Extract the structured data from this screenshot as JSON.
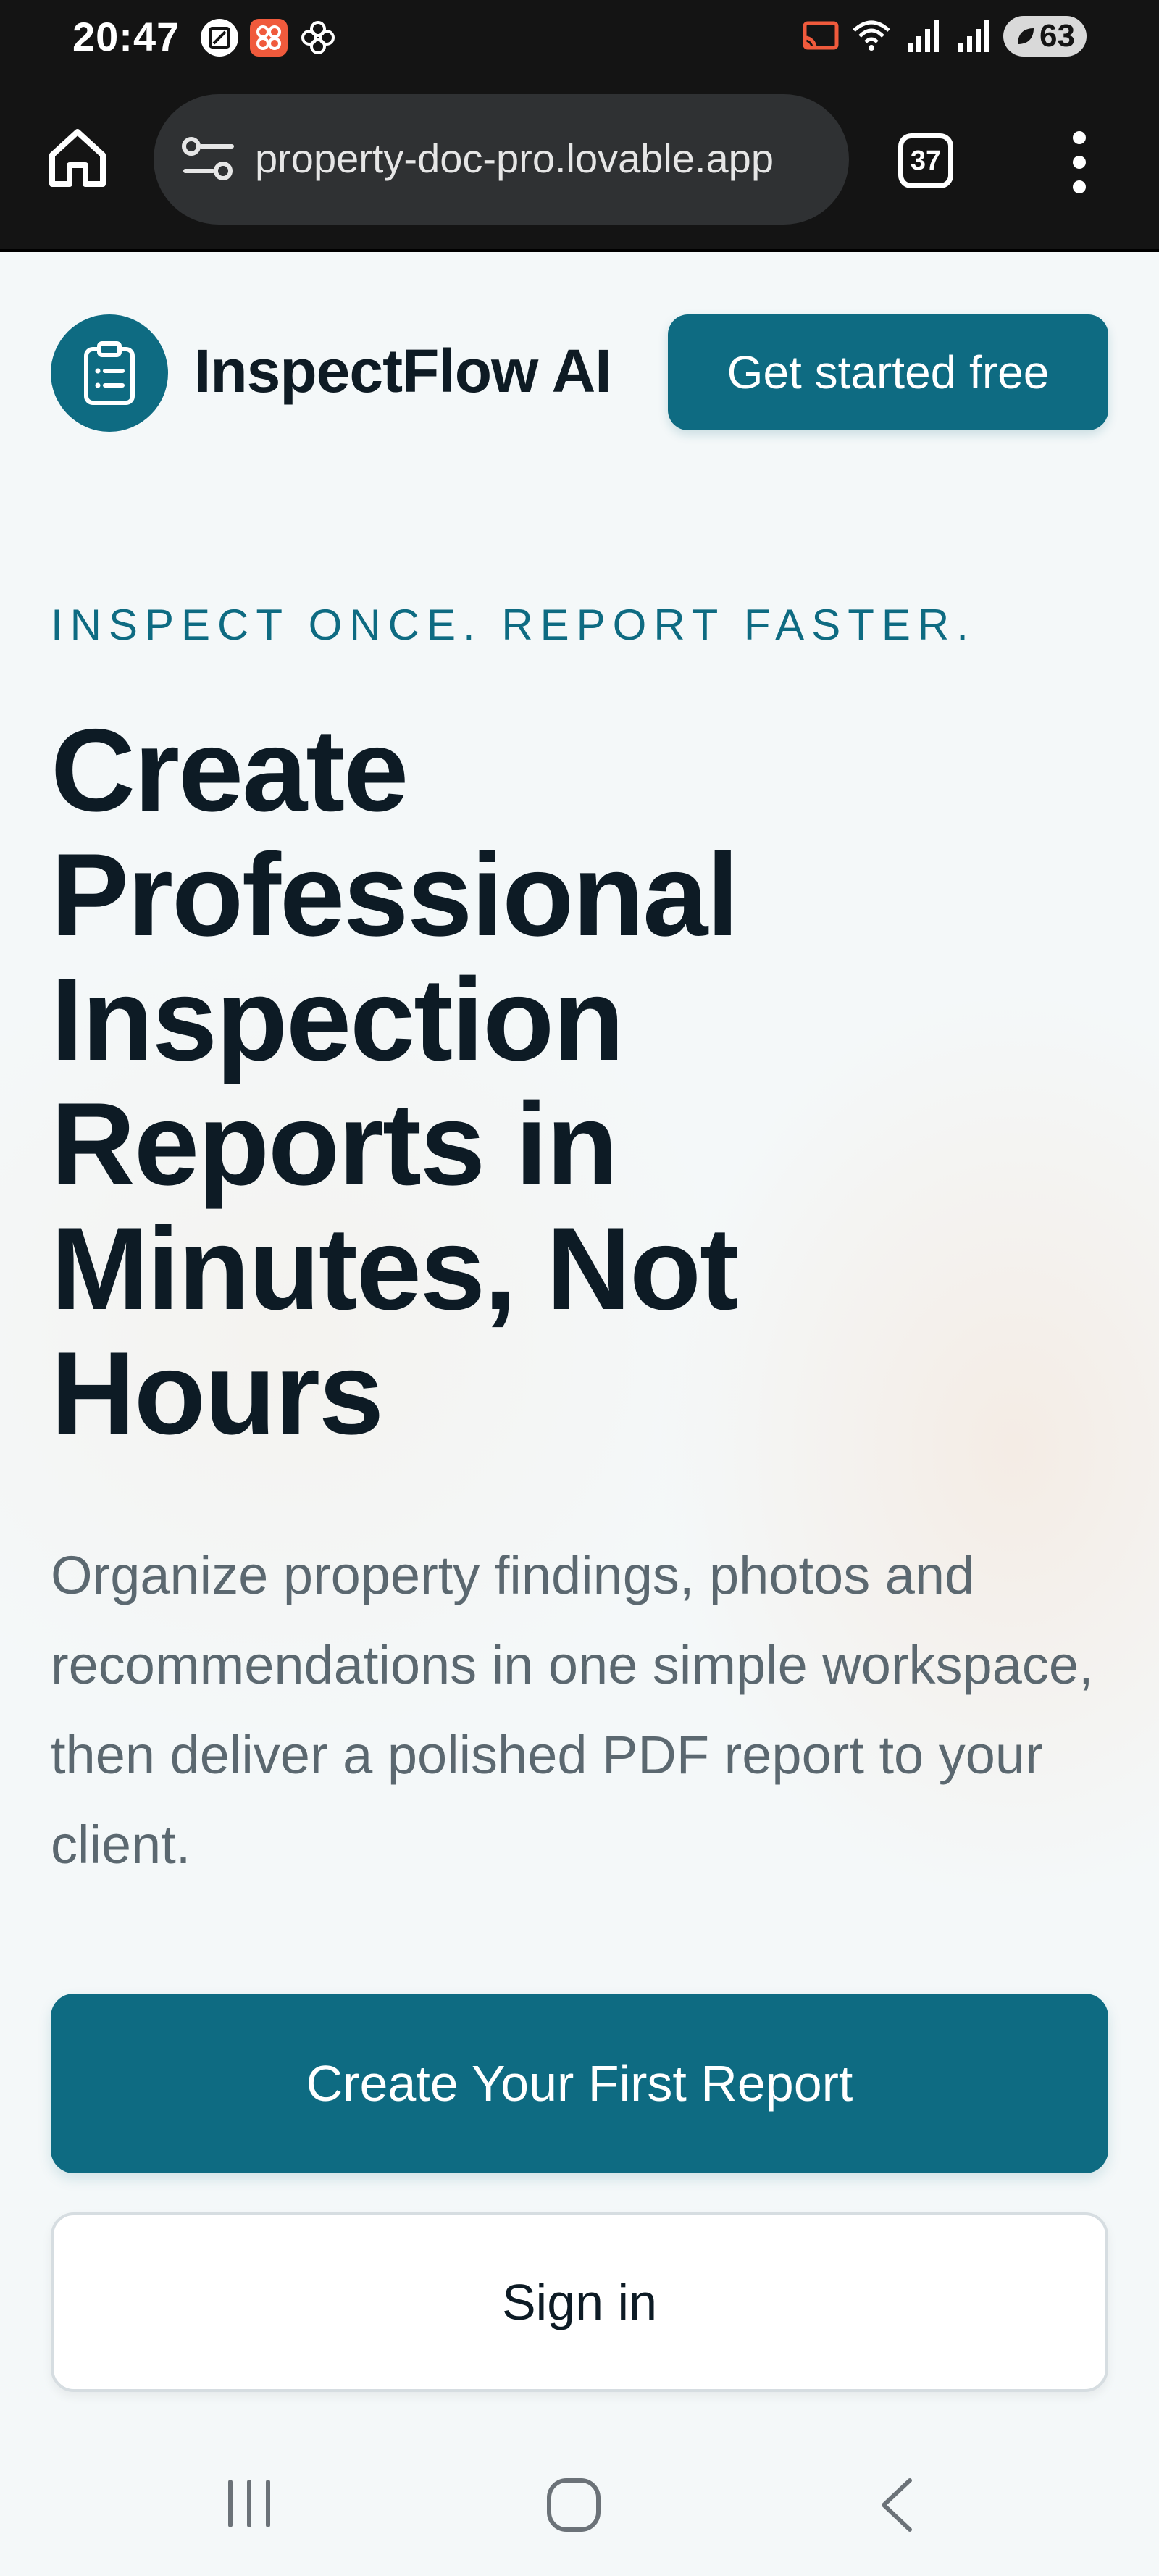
{
  "status_bar": {
    "time": "20:47",
    "battery": "63",
    "left_icons": [
      "screen-record-icon",
      "app-notification-icon",
      "pinwheel-icon"
    ],
    "right_icons": [
      "cast-icon",
      "wifi-icon",
      "signal-icon",
      "signal-icon",
      "battery-icon"
    ]
  },
  "browser": {
    "url": "property-doc-pro.lovable.app",
    "tab_count": "37"
  },
  "site": {
    "name": "InspectFlow AI",
    "header_cta": "Get started free",
    "brand_color": "#0e6b82"
  },
  "hero": {
    "eyebrow": "INSPECT ONCE. REPORT FASTER.",
    "title": "Create Professional Inspection Reports in Minutes, Not Hours",
    "subtitle": "Organize property findings, photos and recommendations in one simple workspace, then deliver a polished PDF report to your client.",
    "primary_cta": "Create Your First Report",
    "secondary_cta": "Sign in"
  },
  "nav_bar": {
    "icons": [
      "recent-apps-icon",
      "home-icon",
      "back-icon"
    ]
  }
}
